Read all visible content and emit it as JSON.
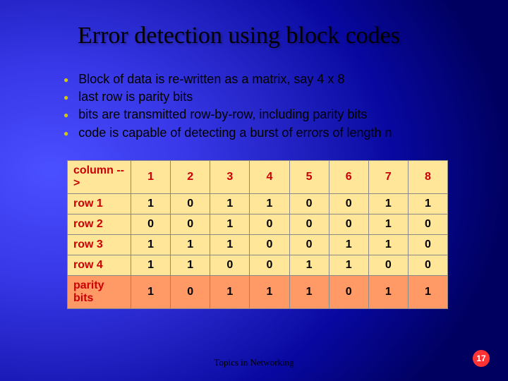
{
  "title": "Error detection using block codes",
  "bullets": [
    "Block of data is re-written as a matrix, say 4 x 8",
    "last row is parity bits",
    "bits are transmitted row-by-row, including parity bits",
    "code is capable of detecting a burst of errors of length n"
  ],
  "table": {
    "header_label": "column -->",
    "columns": [
      "1",
      "2",
      "3",
      "4",
      "5",
      "6",
      "7",
      "8"
    ],
    "rows": [
      {
        "label": "row 1",
        "cells": [
          "1",
          "0",
          "1",
          "1",
          "0",
          "0",
          "1",
          "1"
        ]
      },
      {
        "label": "row 2",
        "cells": [
          "0",
          "0",
          "1",
          "0",
          "0",
          "0",
          "1",
          "0"
        ]
      },
      {
        "label": "row 3",
        "cells": [
          "1",
          "1",
          "1",
          "0",
          "0",
          "1",
          "1",
          "0"
        ]
      },
      {
        "label": "row 4",
        "cells": [
          "1",
          "1",
          "0",
          "0",
          "1",
          "1",
          "0",
          "0"
        ]
      }
    ],
    "parity": {
      "label": "parity bits",
      "cells": [
        "1",
        "0",
        "1",
        "1",
        "1",
        "0",
        "1",
        "1"
      ]
    }
  },
  "footer": "Topics in Networking",
  "page_number": "17",
  "chart_data": {
    "type": "table",
    "title": "Error detection using block codes",
    "columns": [
      "1",
      "2",
      "3",
      "4",
      "5",
      "6",
      "7",
      "8"
    ],
    "rows": [
      {
        "label": "row 1",
        "values": [
          1,
          0,
          1,
          1,
          0,
          0,
          1,
          1
        ]
      },
      {
        "label": "row 2",
        "values": [
          0,
          0,
          1,
          0,
          0,
          0,
          1,
          0
        ]
      },
      {
        "label": "row 3",
        "values": [
          1,
          1,
          1,
          0,
          0,
          1,
          1,
          0
        ]
      },
      {
        "label": "row 4",
        "values": [
          1,
          1,
          0,
          0,
          1,
          1,
          0,
          0
        ]
      },
      {
        "label": "parity bits",
        "values": [
          1,
          0,
          1,
          1,
          1,
          0,
          1,
          1
        ]
      }
    ]
  }
}
